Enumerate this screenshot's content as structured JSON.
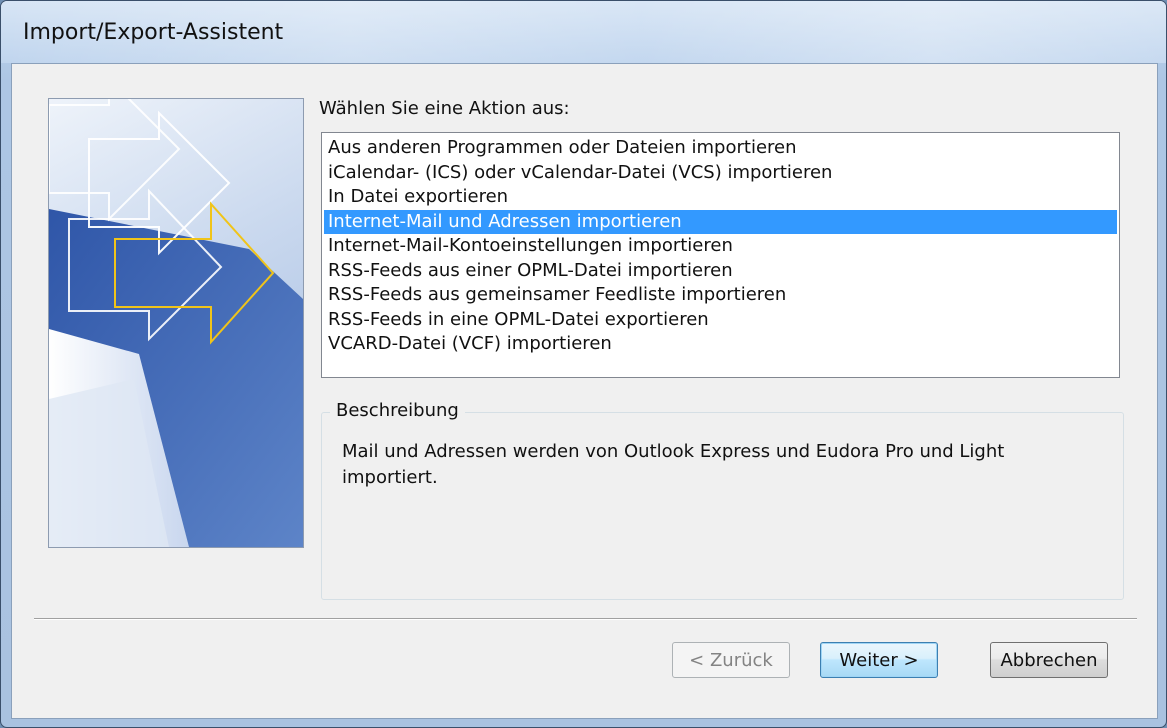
{
  "window": {
    "title": "Import/Export-Assistent"
  },
  "prompt": "Wählen Sie eine Aktion aus:",
  "actions": [
    {
      "label": "Aus anderen Programmen oder Dateien importieren",
      "selected": false
    },
    {
      "label": "iCalendar- (ICS) oder vCalendar-Datei (VCS) importieren",
      "selected": false
    },
    {
      "label": "In Datei exportieren",
      "selected": false
    },
    {
      "label": "Internet-Mail und Adressen importieren",
      "selected": true
    },
    {
      "label": "Internet-Mail-Kontoeinstellungen importieren",
      "selected": false
    },
    {
      "label": "RSS-Feeds aus einer OPML-Datei importieren",
      "selected": false
    },
    {
      "label": "RSS-Feeds aus gemeinsamer Feedliste importieren",
      "selected": false
    },
    {
      "label": "RSS-Feeds in eine OPML-Datei exportieren",
      "selected": false
    },
    {
      "label": "VCARD-Datei (VCF) importieren",
      "selected": false
    }
  ],
  "description": {
    "heading": "Beschreibung",
    "text": "Mail und Adressen werden von Outlook Express und Eudora Pro und Light importiert."
  },
  "buttons": {
    "back": "< Zurück",
    "next": "Weiter >",
    "cancel": "Abbrechen"
  },
  "colors": {
    "selection": "#3399ff",
    "arrow_outline": "#f0c419"
  },
  "icons": {
    "wizard_graphic": "arrows-wizard-graphic"
  }
}
